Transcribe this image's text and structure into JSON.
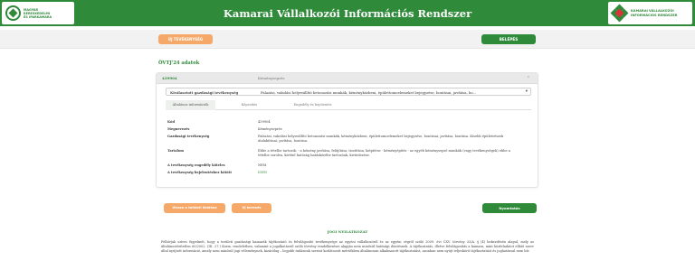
{
  "header": {
    "title": "Kamarai Vállalkozói Információs Rendszer",
    "logo_left_lines": [
      "MAGYAR",
      "KERESKEDELMI",
      "ÉS IPARKAMARA"
    ],
    "logo_right_lines": [
      "KAMARAI VÁLLALKOZÓI",
      "INFORMÁCIÓS RENDSZER"
    ],
    "colors": {
      "brand_green": "#2f8a3a",
      "accent_orange": "#f5a868",
      "logo_red": "#d9343a"
    }
  },
  "actionbar": {
    "new_activity_label": "ÚJ TEVÉKENYSÉG",
    "login_label": "BELÉPÉS"
  },
  "section": {
    "title": "ÖVTJ'24 adatok"
  },
  "card": {
    "code": "439904",
    "name": "Kéményseprés",
    "select_label": "Kiválasztott gazdasági tevékenység",
    "select_value": "Falazási, vakolási helyreállító betonozási munkák, kéményközbeni, épülettomoelemeket bejegyzése, bontásai, javítása, ho...",
    "tabs": [
      "Általános információk",
      "Képesítés",
      "Engedély és bejelentés"
    ],
    "details": [
      {
        "key": "Kód",
        "value": "439904"
      },
      {
        "key": "Megnevezés",
        "value": "Kéményseprés"
      },
      {
        "key": "Gazdasági tevékenység",
        "value": "Falazási, vakolási helyreállító betonozási munkák, kéményközbeni, épülettomoelemeket bejegyzése, bontásai, javítása, bontása. Kisebb épületrészek átalakításai, javítása, bontása."
      },
      {
        "key": "Tartalom",
        "value": "Ebbe a tételbe tartozik: - a kémény javítása, felújítása, tisztítása, kiépítése - kéményépítés - az egyéb kéményseprő munkák (vagy tevékenységek) ebbe a tételbe sorolva, kivétel hatóság hatáskörébe tartozóak, kivitelezése."
      },
      {
        "key": "A tevékenység engedély köteles",
        "value": "NEM"
      },
      {
        "key": "A tevékenység bejelentéshez kötött",
        "value": "IGEN"
      }
    ]
  },
  "bottom": {
    "back_label": "Vissza a találati listához",
    "new_search_label": "Új keresés",
    "print_label": "Nyomtatás"
  },
  "disclaimer": {
    "title": "JOGI NYILATKOZAT",
    "text": "Felhívjuk szíves figyelmét, hogy a területi gazdasági kamarák tájékoztató és felvilágosító tevékenysége az egyéni vállalkozóról és az egyéni cégről szóló 2009. évi CXV. törvény 33/A. § (4) bekezdésén alapul, mely az általánostérítetlen 60/2002. (III. 27.) Korm. rendeletben, valamint a jogalkotásról szóló törvény rendelkezései alapján nem minősül hatósági döntésnek. A tájékoztatás, illetve felvilágosítás a kamara, mint közfeladatot ellátó szerv által nyújtott információ, amely nem minősül jogi véleménynek, kizárólag – legjobb tudásunk szerint korlátozott mértékben általánosan alkalmazott tájékoztatást, azonban nem nyújt teljeskörű tájékoztatást és joghatással nem bír."
  }
}
